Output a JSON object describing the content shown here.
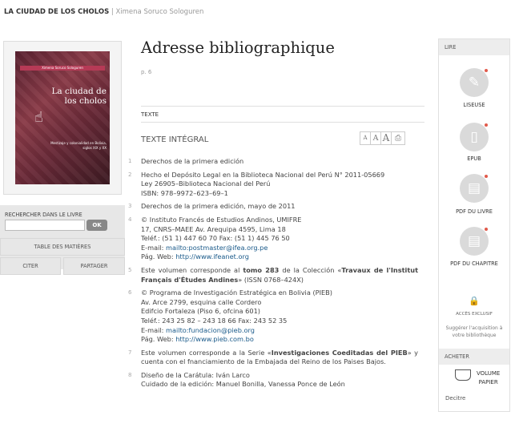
{
  "header": {
    "book_title": "LA CIUDAD DE LOS CHOLOS",
    "separator": "|",
    "author": "Ximena Soruco Sologuren"
  },
  "cover": {
    "author_strip": "Ximena Soruco Sologuren",
    "title": "La ciudad de los cholos",
    "subtitle": "Mestizaje y colonialidad en Bolivia, siglos XIX y XX"
  },
  "search": {
    "label": "RECHERCHER DANS LE LIVRE",
    "placeholder": "",
    "ok": "OK"
  },
  "nav": {
    "toc": "TABLE DES MATIÈRES",
    "cite": "CITER",
    "share": "PARTAGER"
  },
  "main": {
    "title": "Adresse bibliographique",
    "page": "p. 6",
    "section": "TEXTE",
    "full_text": "TEXTE INTÉGRAL",
    "font_small": "A",
    "font_medium": "A",
    "font_large": "A"
  },
  "items": [
    {
      "n": "1",
      "lines": [
        "Derechos de la primera edición"
      ]
    },
    {
      "n": "2",
      "lines": [
        "Hecho el Depósito Legal en la Biblioteca Nacional del Perú N° 2011-05669",
        "Ley 26905–Biblioteca Nacional del Perú",
        "ISBN: 978–9972–623–69–1"
      ]
    },
    {
      "n": "3",
      "lines": [
        "Derechos de la primera edición, mayo de 2011"
      ]
    },
    {
      "n": "4",
      "lines": [
        "© Instituto Francés de Estudios Andinos, UMIFRE",
        "17, CNRS–MAEE Av. Arequipa 4595, Lima 18",
        "Teléf.: (51 1) 447 60 70 Fax: (51 1) 445 76 50"
      ]
    },
    {
      "n": "5",
      "pre": "Este volumen corresponde al ",
      "bold": "tomo 283",
      "mid": " de la Colección «",
      "bold2": "Travaux de l'Institut Français d'Études Andines",
      "post": "» (ISSN 0768–424X)"
    },
    {
      "n": "6",
      "lines": [
        "© Programa de Investigación Estratégica en Bolivia (PIEB)",
        "Av. Arce 2799, esquina calle Cordero",
        "Edifcio Fortaleza (Piso 6, ofcina 601)",
        "Teléf.: 243 25 82 – 243 18 66 Fax: 243 52 35"
      ]
    },
    {
      "n": "7",
      "pre": "Este volumen corresponde a la Serie «",
      "bold": "Investigaciones Coeditadas del PIEB",
      "post": "» y cuenta con el fnanciamiento de la Embajada del Reino de los Paises Bajos."
    },
    {
      "n": "8",
      "lines": [
        "Diseño de la Carátula: Iván Larco",
        "Cuidado de la edición: Manuel Bonilla, Vanessa Ponce de León"
      ]
    }
  ],
  "links": {
    "email_label": "E-mail: ",
    "email4": "mailto:postmaster@ifea.org.pe",
    "web_label": "Pág. Web: ",
    "web4": "http://www.ifeanet.org",
    "email6": "mailto:fundacion@pieb.org",
    "web6": "http://www.pieb.com.bo"
  },
  "sidebar": {
    "lire": "LIRE",
    "liseuse": "LISEUSE",
    "epub": "EPUB",
    "pdf_livre": "PDF DU LIVRE",
    "pdf_chapitre": "PDF DU CHAPITRE",
    "acces": "ACCÈS EXCLUSIF",
    "suggest": "Suggérer l'acquisition à votre bibliothèque",
    "acheter": "ACHETER",
    "volume": "VOLUME",
    "papier": "PAPIER",
    "store": "Decitre"
  },
  "colors": {
    "accent": "#e15a4b",
    "link": "#1a5a8a"
  }
}
